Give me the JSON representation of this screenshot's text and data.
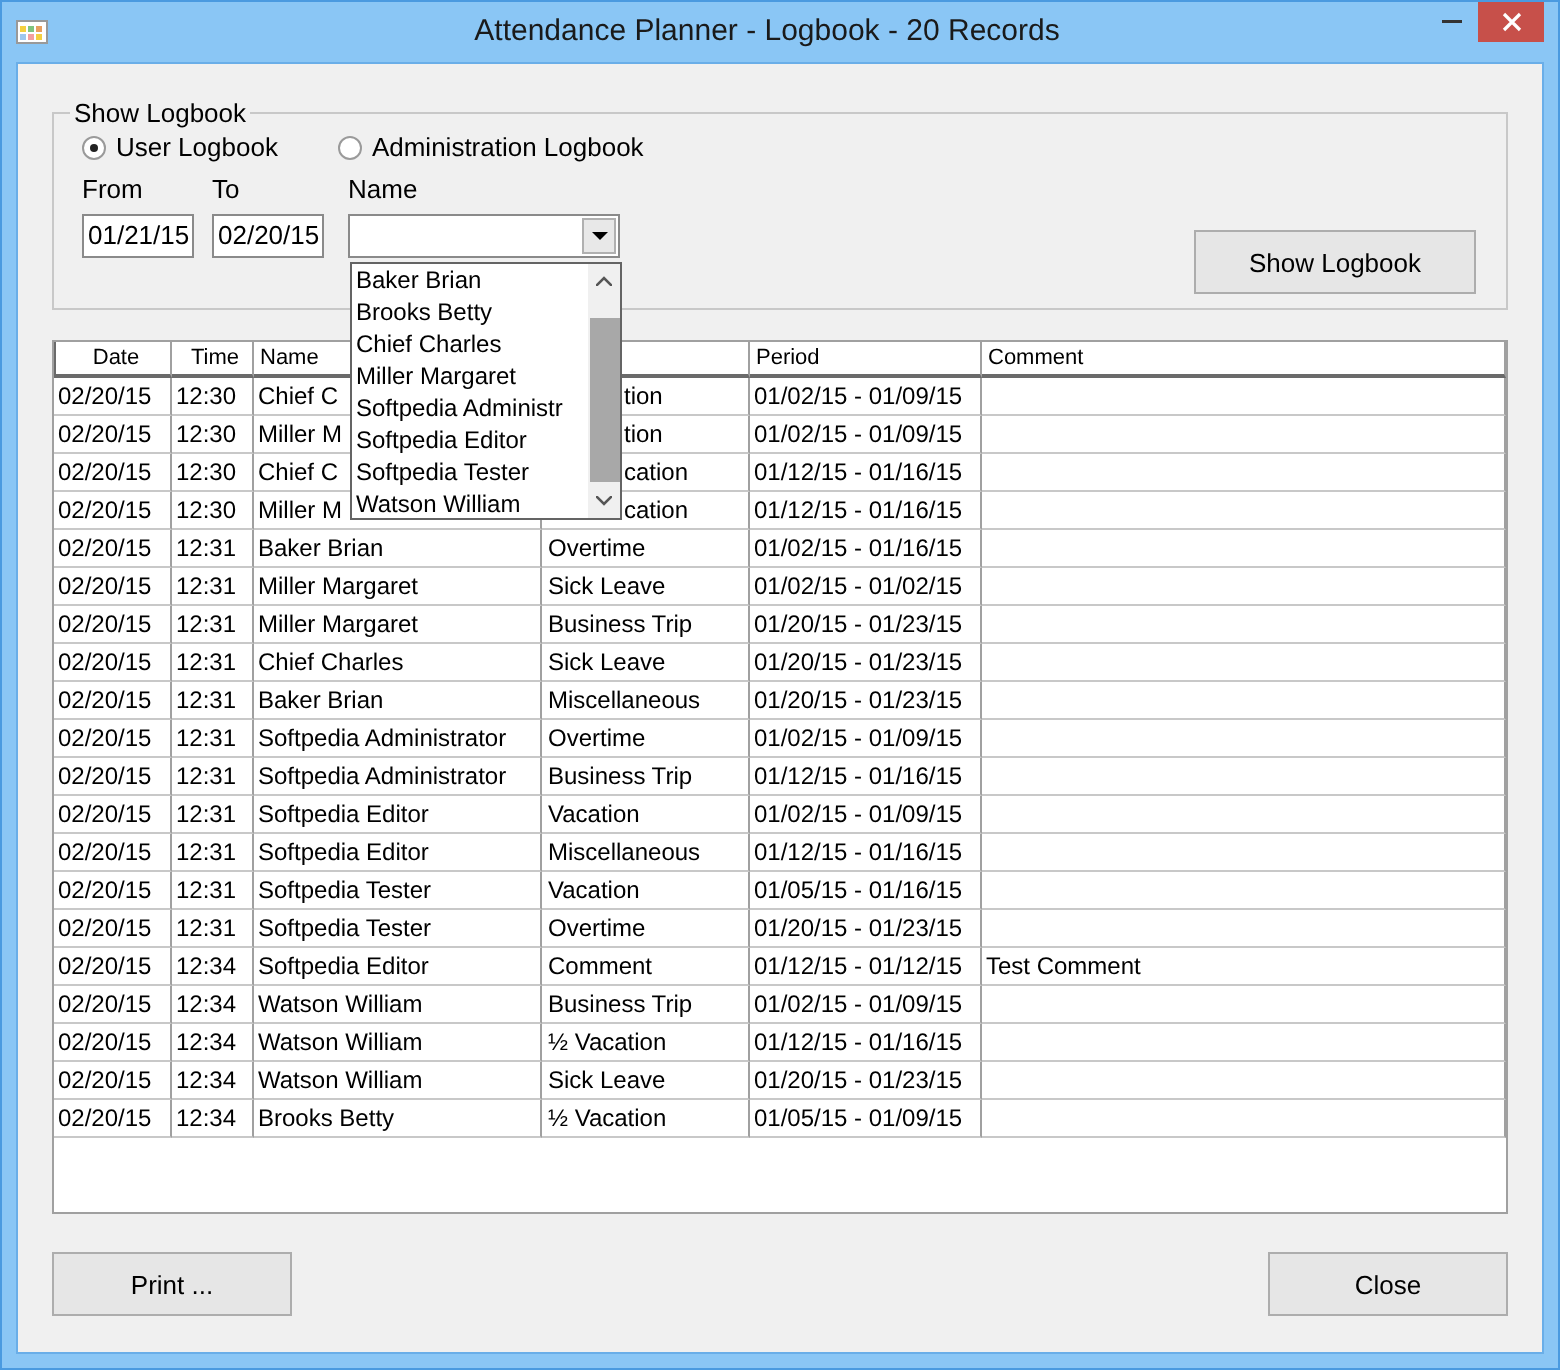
{
  "window": {
    "title": "Attendance Planner - Logbook - 20 Records"
  },
  "filter": {
    "group_title": "Show Logbook",
    "radios": [
      {
        "label": "User Logbook",
        "selected": true
      },
      {
        "label": "Administration Logbook",
        "selected": false
      }
    ],
    "from_label": "From",
    "from_value": "01/21/15",
    "to_label": "To",
    "to_value": "02/20/15",
    "name_label": "Name",
    "name_options": [
      "Baker Brian",
      "Brooks Betty",
      "Chief Charles",
      "Miller Margaret",
      "Softpedia Administr",
      "Softpedia Editor",
      "Softpedia Tester",
      "Watson William"
    ],
    "show_button": "Show Logbook"
  },
  "table": {
    "columns": [
      {
        "label": "Date"
      },
      {
        "label": "Time"
      },
      {
        "label": "Name"
      },
      {},
      {
        "label": "Period"
      },
      {
        "label": "Comment"
      }
    ],
    "rows": [
      {
        "kind": "covered",
        "date": "02/20/15",
        "time": "12:30",
        "name": "Chief C",
        "type": "tion",
        "period": "01/02/15 - 01/09/15"
      },
      {
        "kind": "covered",
        "date": "02/20/15",
        "time": "12:30",
        "name": "Miller M",
        "type": "tion",
        "period": "01/02/15 - 01/09/15"
      },
      {
        "kind": "covered",
        "date": "02/20/15",
        "time": "12:30",
        "name": "Chief C",
        "type": "cation",
        "period": "01/12/15 - 01/16/15"
      },
      {
        "kind": "covered",
        "date": "02/20/15",
        "time": "12:30",
        "name": "Miller M",
        "type": "cation",
        "period": "01/12/15 - 01/16/15"
      },
      {
        "kind": "plain",
        "date": "02/20/15",
        "time": "12:31",
        "name": "Baker Brian",
        "type": "Overtime",
        "period": "01/02/15 - 01/16/15"
      },
      {
        "kind": "plain",
        "date": "02/20/15",
        "time": "12:31",
        "name": "Miller Margaret",
        "type": "Sick Leave",
        "period": "01/02/15 - 01/02/15"
      },
      {
        "kind": "plain",
        "date": "02/20/15",
        "time": "12:31",
        "name": "Miller Margaret",
        "type": "Business Trip",
        "period": "01/20/15 - 01/23/15"
      },
      {
        "kind": "plain",
        "date": "02/20/15",
        "time": "12:31",
        "name": "Chief Charles",
        "type": "Sick Leave",
        "period": "01/20/15 - 01/23/15"
      },
      {
        "kind": "plain",
        "date": "02/20/15",
        "time": "12:31",
        "name": "Baker Brian",
        "type": "Miscellaneous",
        "period": "01/20/15 - 01/23/15"
      },
      {
        "kind": "plain",
        "date": "02/20/15",
        "time": "12:31",
        "name": "Softpedia Administrator",
        "type": "Overtime",
        "period": "01/02/15 - 01/09/15"
      },
      {
        "kind": "plain",
        "date": "02/20/15",
        "time": "12:31",
        "name": "Softpedia Administrator",
        "type": "Business Trip",
        "period": "01/12/15 - 01/16/15"
      },
      {
        "kind": "plain",
        "date": "02/20/15",
        "time": "12:31",
        "name": "Softpedia Editor",
        "type": "Vacation",
        "period": "01/02/15 - 01/09/15"
      },
      {
        "kind": "plain",
        "date": "02/20/15",
        "time": "12:31",
        "name": "Softpedia Editor",
        "type": "Miscellaneous",
        "period": "01/12/15 - 01/16/15"
      },
      {
        "kind": "plain",
        "date": "02/20/15",
        "time": "12:31",
        "name": "Softpedia Tester",
        "type": "Vacation",
        "period": "01/05/15 - 01/16/15"
      },
      {
        "kind": "plain",
        "date": "02/20/15",
        "time": "12:31",
        "name": "Softpedia Tester",
        "type": "Overtime",
        "period": "01/20/15 - 01/23/15"
      },
      {
        "kind": "plain",
        "date": "02/20/15",
        "time": "12:34",
        "name": "Softpedia Editor",
        "type": "Comment",
        "period": "01/12/15 - 01/12/15",
        "comment": "Test Comment"
      },
      {
        "kind": "plain",
        "date": "02/20/15",
        "time": "12:34",
        "name": "Watson William",
        "type": "Business Trip",
        "period": "01/02/15 - 01/09/15"
      },
      {
        "kind": "plain",
        "date": "02/20/15",
        "time": "12:34",
        "name": "Watson William",
        "type": "½ Vacation",
        "period": "01/12/15 - 01/16/15"
      },
      {
        "kind": "plain",
        "date": "02/20/15",
        "time": "12:34",
        "name": "Watson William",
        "type": "Sick Leave",
        "period": "01/20/15 - 01/23/15"
      },
      {
        "kind": "plain",
        "date": "02/20/15",
        "time": "12:34",
        "name": "Brooks Betty",
        "type": "½ Vacation",
        "period": "01/05/15 - 01/09/15"
      }
    ]
  },
  "buttons": {
    "print": "Print ...",
    "close": "Close"
  }
}
